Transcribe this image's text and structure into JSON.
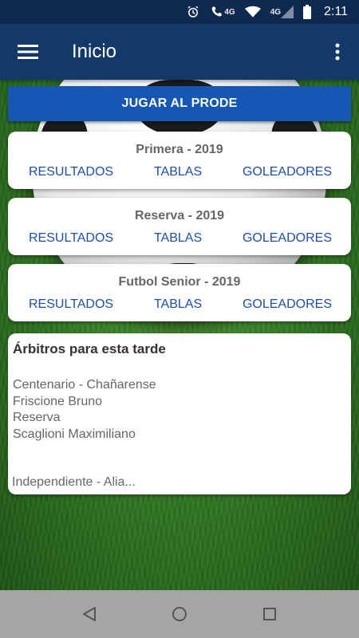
{
  "status_bar": {
    "net_label": "4G",
    "net_label_2": "4G",
    "time": "2:11"
  },
  "app_bar": {
    "title": "Inicio"
  },
  "prode_button": "JUGAR AL PRODE",
  "leagues": [
    {
      "title": "Primera - 2019",
      "results": "RESULTADOS",
      "tables": "TABLAS",
      "scorers": "GOLEADORES"
    },
    {
      "title": "Reserva - 2019",
      "results": "RESULTADOS",
      "tables": "TABLAS",
      "scorers": "GOLEADORES"
    },
    {
      "title": "Futbol Senior - 2019",
      "results": "RESULTADOS",
      "tables": "TABLAS",
      "scorers": "GOLEADORES"
    }
  ],
  "referees": {
    "title": "Árbitros para esta tarde",
    "lines": [
      "Centenario - Chañarense",
      "Friscione Bruno",
      "Reserva",
      "Scaglioni Maximiliano"
    ],
    "footer": "Independiente - Alia..."
  },
  "colors": {
    "app_bar": "#12396a",
    "accent_button": "#1656b5",
    "link": "#1a4fb0"
  },
  "icons": {
    "menu": "hamburger-menu-icon",
    "more": "more-vert-icon",
    "back": "nav-back-icon",
    "home": "nav-home-icon",
    "recents": "nav-recents-icon"
  }
}
